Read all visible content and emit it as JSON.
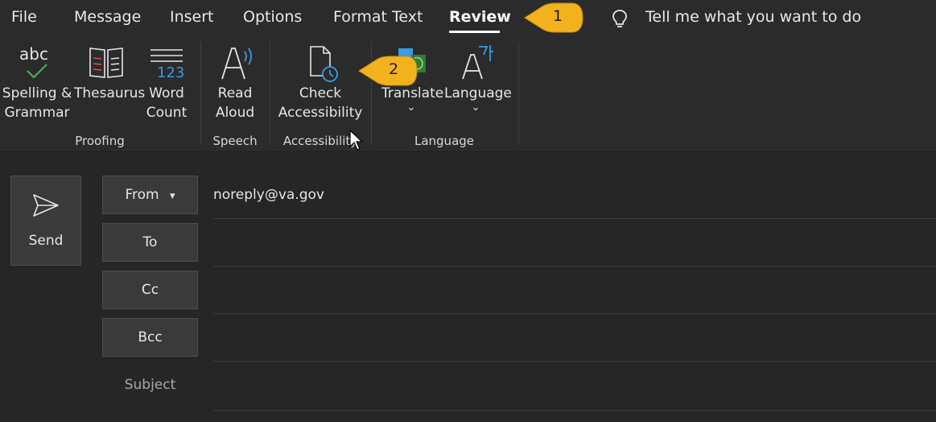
{
  "menu": {
    "tabs": [
      {
        "label": "File"
      },
      {
        "label": "Message"
      },
      {
        "label": "Insert"
      },
      {
        "label": "Options"
      },
      {
        "label": "Format Text"
      },
      {
        "label": "Review"
      }
    ],
    "active_tab": "Review",
    "tell_me": "Tell me what you want to do"
  },
  "ribbon": {
    "proofing": {
      "spelling_line1": "Spelling &",
      "spelling_line2": "Grammar",
      "thesaurus": "Thesaurus",
      "word_count_line1": "Word",
      "word_count_line2": "Count",
      "group_label": "Proofing"
    },
    "speech": {
      "read_aloud_line1": "Read",
      "read_aloud_line2": "Aloud",
      "group_label": "Speech"
    },
    "accessibility": {
      "check_line1": "Check",
      "check_line2": "Accessibility",
      "group_label": "Accessibility"
    },
    "language": {
      "translate": "Translate",
      "language": "Language",
      "group_label": "Language"
    },
    "icon_text": {
      "abc": "abc",
      "num": "123"
    }
  },
  "compose": {
    "send_label": "Send",
    "from_label": "From",
    "from_value": "noreply@va.gov",
    "to_label": "To",
    "cc_label": "Cc",
    "bcc_label": "Bcc",
    "subject_label": "Subject"
  },
  "callouts": [
    {
      "number": "1"
    },
    {
      "number": "2"
    }
  ],
  "colors": {
    "background": "#262626",
    "ribbon": "#2b2b2b",
    "accent_blue": "#3b9be0",
    "callout_yellow": "#f2b21e",
    "spelling_check": "#4caf50"
  }
}
